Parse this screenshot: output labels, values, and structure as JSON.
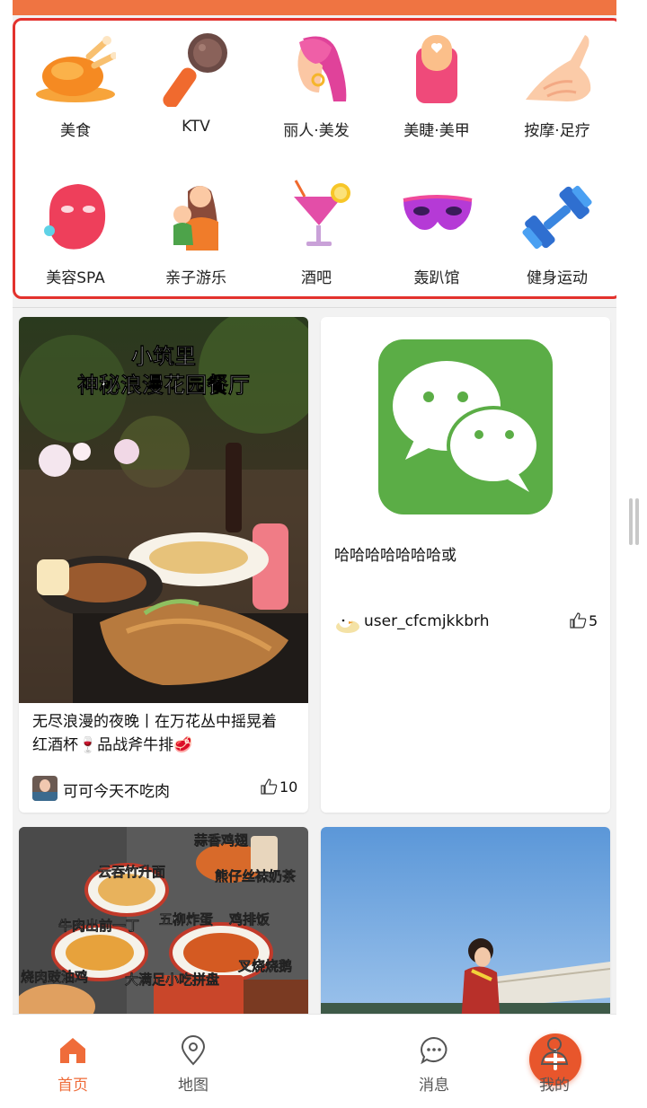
{
  "categories": [
    {
      "label": "美食",
      "icon": "roast-chicken-icon"
    },
    {
      "label": "KTV",
      "icon": "microphone-icon"
    },
    {
      "label": "丽人·美发",
      "icon": "woman-hair-icon"
    },
    {
      "label": "美睫·美甲",
      "icon": "nail-icon"
    },
    {
      "label": "按摩·足疗",
      "icon": "massage-hand-icon"
    },
    {
      "label": "美容SPA",
      "icon": "face-mask-icon"
    },
    {
      "label": "亲子游乐",
      "icon": "mother-child-icon"
    },
    {
      "label": "酒吧",
      "icon": "cocktail-icon"
    },
    {
      "label": "轰趴馆",
      "icon": "party-mask-icon"
    },
    {
      "label": "健身运动",
      "icon": "dumbbell-icon"
    }
  ],
  "feed": [
    {
      "image_text_line1": "小筑里",
      "image_text_line2": "神秘浪漫花园餐厅",
      "title_line1": "无尽浪漫的夜晚丨在万花丛中摇晃着",
      "title_line2": "红酒杯🍷品战斧牛排🥩",
      "author": "可可今天不吃肉",
      "likes": "10"
    },
    {
      "title": "哈哈哈哈哈哈哈或",
      "author": "user_cfcmjkkbrh",
      "likes": "5",
      "icon": "wechat-icon"
    },
    {
      "image_labels": [
        "蒜香鸡翅",
        "云吞竹升面",
        "熊仔丝袜奶茶",
        "牛肉出前一丁",
        "五柳炸蛋",
        "鸡排饭",
        "烧肉豉油鸡",
        "大满足小吃拼盘",
        "叉烧烧鹅"
      ]
    },
    {
      "image": "outdoor-photo"
    }
  ],
  "tabbar": [
    {
      "label": "首页",
      "icon": "home-icon",
      "active": true
    },
    {
      "label": "地图",
      "icon": "map-pin-icon",
      "active": false
    },
    {
      "label": "",
      "icon": "plus-icon",
      "active": false
    },
    {
      "label": "消息",
      "icon": "message-icon",
      "active": false
    },
    {
      "label": "我的",
      "icon": "user-icon",
      "active": false
    }
  ],
  "colors": {
    "accent": "#ef6c3a",
    "highlight_border": "#e3322d",
    "wechat_green": "#5bad46"
  }
}
